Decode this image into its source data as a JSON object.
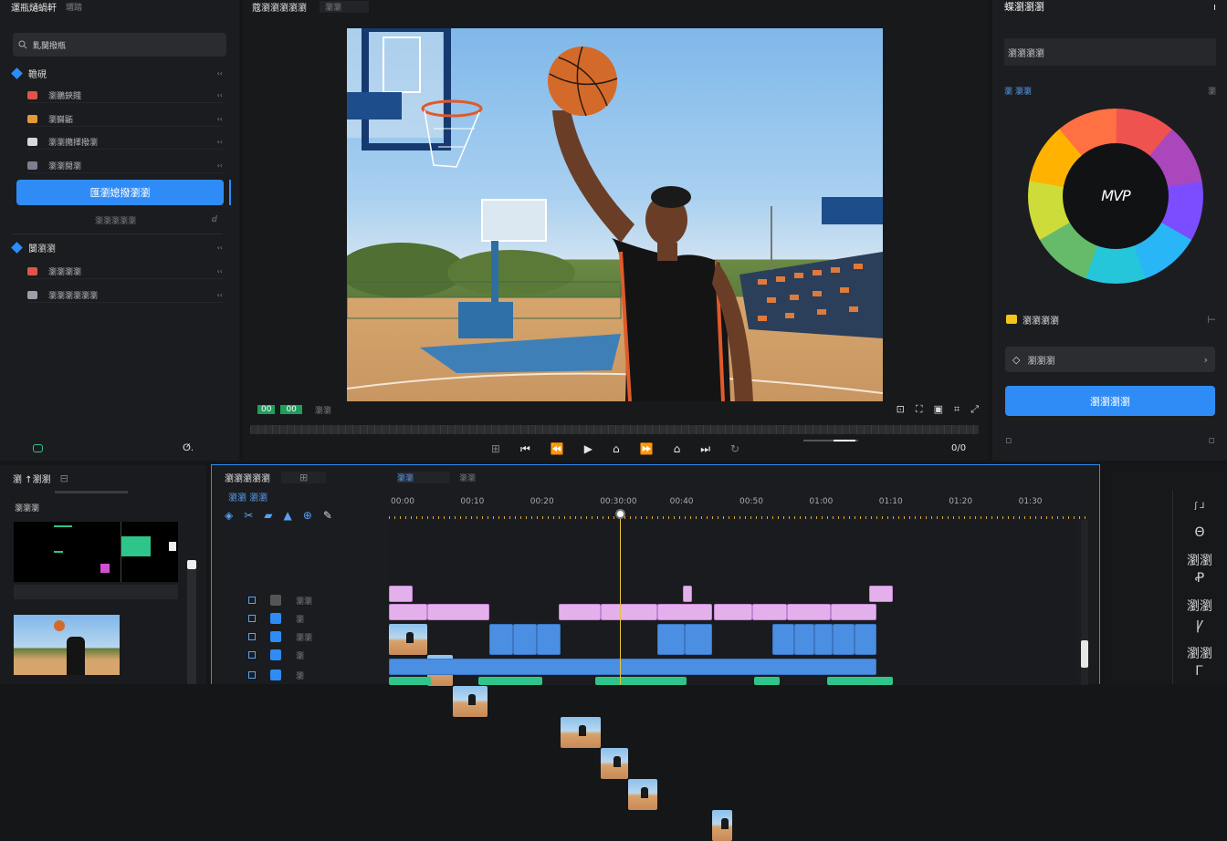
{
  "left_panel": {
    "header": {
      "title": "運瓶熥蝸軒",
      "tab": "瑂踏"
    },
    "search_label": "䵝闅撥瓶",
    "section1": {
      "title": "韂硯",
      "items": [
        {
          "label": "瀏鵬鋏賤",
          "icon": "film-icon",
          "color": "#e0554a"
        },
        {
          "label": "瀏巋鼫",
          "icon": "image-icon",
          "color": "#e39a36"
        },
        {
          "label": "瀏瀏撱擇撥瀏",
          "icon": "audio-icon",
          "color": "#d8d8d8"
        },
        {
          "label": "瀏瀏閱瀏",
          "icon": "text-icon",
          "color": "#7a8090"
        }
      ]
    },
    "import_button": "匯瀏媳撥瀏瀏",
    "import_sub": "瀏瀏瀏瀏瀏",
    "section2": {
      "title": "闅瀏瀏",
      "items": [
        {
          "label": "瀏瀏瀏瀏",
          "icon": "globe-icon",
          "color": "#e0554a"
        },
        {
          "label": "瀏瀏瀏瀏瀏瀏",
          "icon": "folder-icon",
          "color": "#9aa0a8"
        }
      ]
    },
    "footer_right": "ⵚ."
  },
  "preview": {
    "header_title": "蔻瀏瀏瀏瀏瀏",
    "header_tab": "瀏瀏",
    "timecode_a": "00",
    "timecode_b": "00",
    "timecode_c": "瀏瀏",
    "right_time": "0/0"
  },
  "right_panel": {
    "title": "蝶瀏瀏瀏",
    "close": "ı",
    "effect_label": "瀏瀏瀏瀏",
    "sub_left": "瀏 瀏瀏",
    "sub_right": "瀏",
    "wheel_text": "MVP",
    "wheel_colors": [
      "#ef5350",
      "#ab47bc",
      "#7c4dff",
      "#29b6f6",
      "#26c6da",
      "#66bb6a",
      "#cddc39",
      "#ffb300",
      "#ff7043"
    ],
    "option_label": "瀏瀏瀏瀏",
    "option_icon_color": "#f5c518",
    "dropdown_label": "瀏瀏瀏",
    "apply_button": "瀏瀏瀏瀏"
  },
  "bottom_left": {
    "title": "瀏 ↑瀏瀏",
    "label": "瀏瀏瀏"
  },
  "timeline": {
    "title": "瀏瀏瀏瀏瀏",
    "tabs": [
      "瀏瀏",
      "瀏瀏"
    ],
    "toolbar_top": "瀏瀏 瀏瀏",
    "ruler": [
      "00:00",
      "00:10",
      "00:20",
      "00:30:00",
      "00:40",
      "00:50",
      "01:00",
      "01:10",
      "01:20",
      "01:30"
    ],
    "track_labels": [
      "瀏瀏",
      "瀏",
      "瀏瀏",
      "瀏",
      "瀏"
    ]
  },
  "right_tools": {
    "items": [
      "ʃ ⅃",
      "Θ",
      "瀏瀏",
      "Ꝓ",
      "瀏瀏",
      "Ꝩ",
      "瀏瀏",
      "Ꮁ"
    ]
  }
}
